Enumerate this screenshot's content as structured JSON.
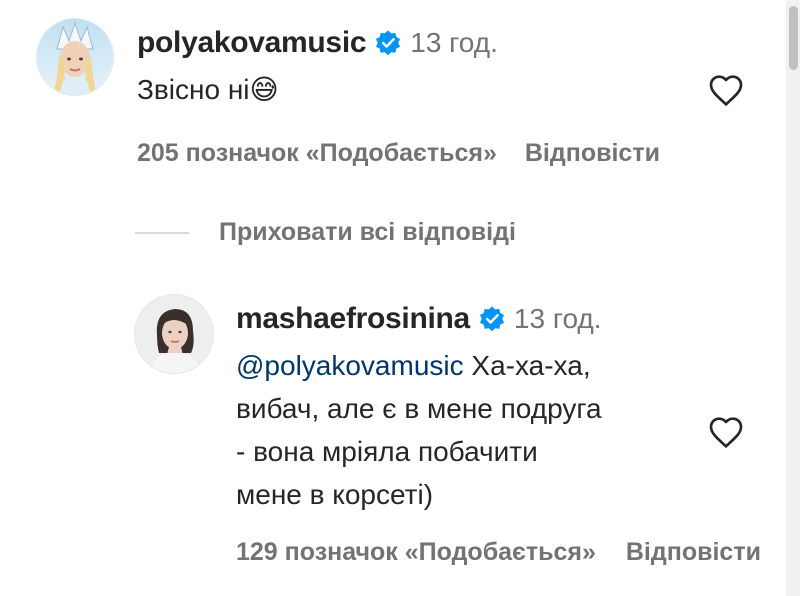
{
  "comments": [
    {
      "username": "polyakovamusic",
      "time": "13 год.",
      "text": "Звісно ні😅",
      "likes_label": "205 позначок «Подобається»",
      "reply_label": "Відповісти"
    }
  ],
  "replies_toggle": {
    "label": "Приховати всі відповіді"
  },
  "replies": [
    {
      "username": "mashaefrosinina",
      "time": "13 год.",
      "mention": "@polyakovamusic",
      "text_line1": " Ха-ха-ха,",
      "text_line2": "вибач, але є в мене подруга",
      "text_line3": "- вона мріяла побачити",
      "text_line4": "мене в корсеті)",
      "likes_label": "129 позначок «Подобається»",
      "reply_label": "Відповісти"
    }
  ],
  "colors": {
    "primary_text": "#262626",
    "secondary_text": "#737373",
    "verified_blue": "#0095f6",
    "mention": "#00376b",
    "divider": "#dbdbdb"
  },
  "icons": {
    "verified": "verified-badge-icon",
    "like": "heart-outline-icon"
  }
}
